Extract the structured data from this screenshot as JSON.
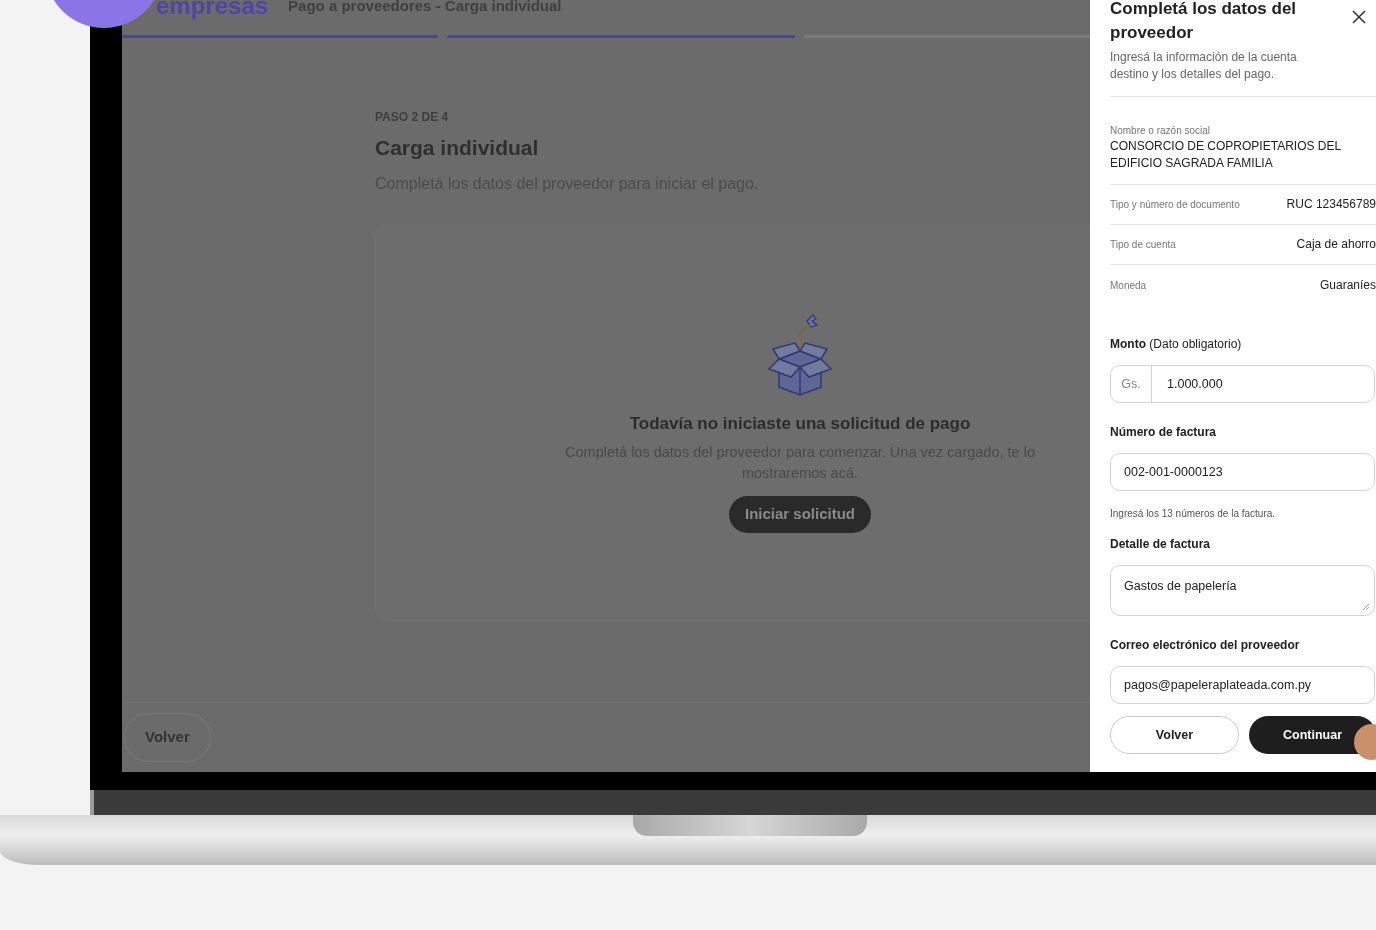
{
  "header": {
    "logo": "empresas",
    "title": "Pago a proveedores - Carga individual"
  },
  "progress": [
    {
      "done": true
    },
    {
      "done": true
    },
    {
      "done": false
    }
  ],
  "step": {
    "label": "PASO 2 DE 4",
    "title": "Carga individual",
    "subtitle": "Completá los datos del proveedor para iniciar el pago."
  },
  "empty_state": {
    "title": "Todavía no iniciaste una solicitud de pago",
    "text": "Completá los datos del proveedor para comenzar. Una vez cargado, te lo mostraremos acá.",
    "button": "Iniciar solicitud"
  },
  "footer": {
    "back_button": "Volver"
  },
  "drawer": {
    "title": "Completá los datos del proveedor",
    "subtitle": "Ingresá la información de la cuenta destino y los detalles del pago.",
    "details": [
      {
        "kind": "stacked",
        "label": "Nombre o razón social",
        "value": "CONSORCIO DE COPROPIETARIOS DEL EDIFICIO SAGRADA FAMILIA"
      },
      {
        "kind": "inline",
        "label": "Tipo y número de documento",
        "value": "RUC 123456789"
      },
      {
        "kind": "inline",
        "label": "Tipo de cuenta",
        "value": "Caja de ahorro"
      },
      {
        "kind": "inline",
        "label": "Moneda",
        "value": "Guaraníes"
      }
    ],
    "fields": [
      {
        "kind": "amount",
        "label": "**Monto** (Dato obligatorio)",
        "prefix": "Gs.",
        "value": "1.000.000"
      },
      {
        "kind": "text",
        "label": "Número de factura",
        "value": "002-001-0000123",
        "help": "Ingresá los 13 números de la factura."
      },
      {
        "kind": "textarea",
        "label": "Detalle de factura",
        "value": "Gastos de papelería"
      },
      {
        "kind": "text",
        "label": "Correo electrónico del proveedor",
        "value": "pagos@papeleraplateada.com.py"
      }
    ],
    "buttons": [
      {
        "kind": "secondary",
        "label": "Volver"
      },
      {
        "kind": "primary",
        "label": "Continuar"
      }
    ]
  }
}
